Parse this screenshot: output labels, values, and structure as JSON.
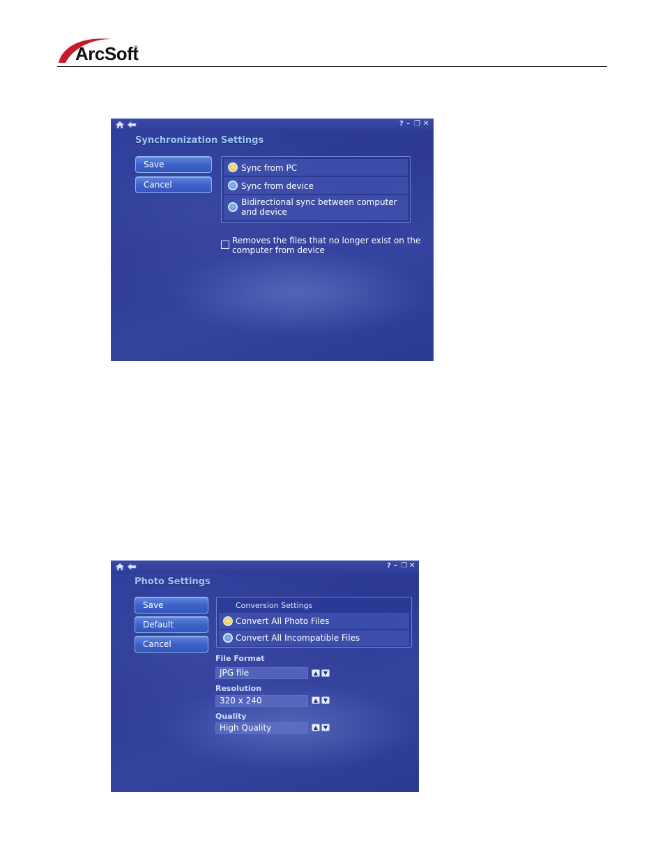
{
  "header": {
    "logo_text": "ArcSoft",
    "logo_reg": "®",
    "brand_color": "#c41a2c"
  },
  "window_chrome": {
    "home_icon": "home-icon",
    "back_icon": "back-arrow-icon",
    "help": "?",
    "minimize": "–",
    "restore": "❐",
    "close": "✕"
  },
  "sync_window": {
    "title": "Synchronization Settings",
    "buttons": {
      "save": "Save",
      "cancel": "Cancel"
    },
    "options": [
      {
        "label": "Sync from PC",
        "selected": true
      },
      {
        "label": "Sync from device",
        "selected": false
      },
      {
        "label": "Bidirectional sync between computer and device",
        "selected": false
      }
    ],
    "option3_line1": "Bidirectional sync between computer",
    "option3_line2": "and device",
    "remove_checkbox": {
      "line1": "Removes the files that no longer exist on the",
      "line2": "computer from device",
      "checked": false
    }
  },
  "photo_window": {
    "title": "Photo Settings",
    "buttons": {
      "save": "Save",
      "default": "Default",
      "cancel": "Cancel"
    },
    "conversion": {
      "header": "Conversion Settings",
      "options": [
        {
          "label": "Convert All Photo Files",
          "selected": true
        },
        {
          "label": "Convert All Incompatible Files",
          "selected": false
        }
      ]
    },
    "file_format": {
      "label": "File Format",
      "value": "JPG file"
    },
    "resolution": {
      "label": "Resolution",
      "value": "320 x 240"
    },
    "quality": {
      "label": "Quality",
      "value": "High Quality"
    },
    "spin_up": "▲",
    "spin_down": "▼"
  }
}
